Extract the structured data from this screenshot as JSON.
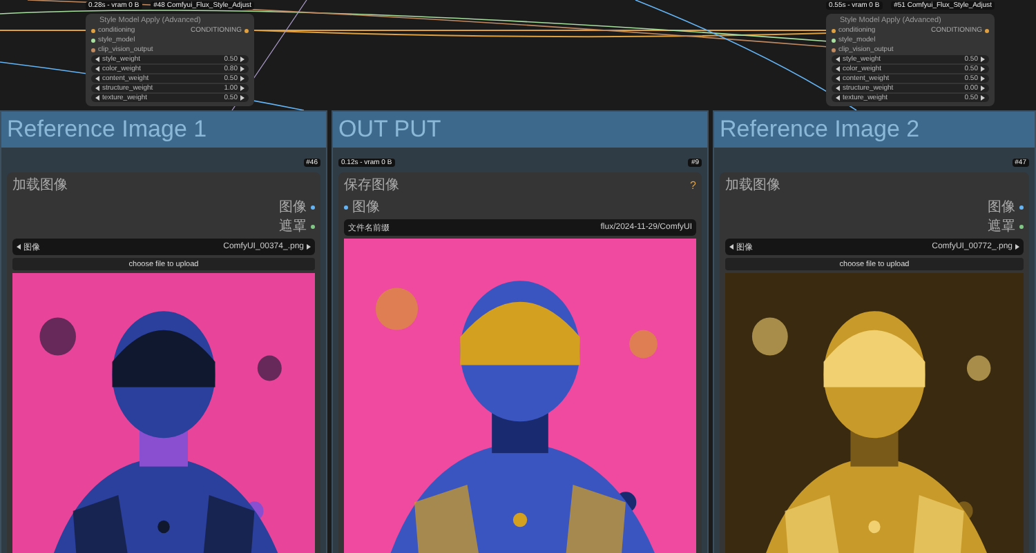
{
  "canvas_nodes": [
    {
      "timing": "0.28s - vram 0 B",
      "badge": "#48 Comfyui_Flux_Style_Adjust",
      "title": "Style Model Apply (Advanced)",
      "inputs": [
        {
          "name": "conditioning",
          "color": "#e0a040"
        },
        {
          "name": "style_model",
          "color": "#a8e0a0"
        },
        {
          "name": "clip_vision_output",
          "color": "#c08a60"
        }
      ],
      "output": {
        "name": "CONDITIONING",
        "color": "#e0a040"
      },
      "widgets": [
        {
          "label": "style_weight",
          "value": "0.50"
        },
        {
          "label": "color_weight",
          "value": "0.80"
        },
        {
          "label": "content_weight",
          "value": "0.50"
        },
        {
          "label": "structure_weight",
          "value": "1.00"
        },
        {
          "label": "texture_weight",
          "value": "0.50"
        }
      ]
    },
    {
      "timing": "0.55s - vram 0 B",
      "badge": "#51 Comfyui_Flux_Style_Adjust",
      "title": "Style Model Apply (Advanced)",
      "inputs": [
        {
          "name": "conditioning",
          "color": "#e0a040"
        },
        {
          "name": "style_model",
          "color": "#a8e0a0"
        },
        {
          "name": "clip_vision_output",
          "color": "#c08a60"
        }
      ],
      "output": {
        "name": "CONDITIONING",
        "color": "#e0a040"
      },
      "widgets": [
        {
          "label": "style_weight",
          "value": "0.50"
        },
        {
          "label": "color_weight",
          "value": "0.50"
        },
        {
          "label": "content_weight",
          "value": "0.50"
        },
        {
          "label": "structure_weight",
          "value": "0.00"
        },
        {
          "label": "texture_weight",
          "value": "0.50"
        }
      ]
    }
  ],
  "groups": [
    {
      "title": "Reference Image 1",
      "node": {
        "kind": "load_image",
        "badge": "#46",
        "title": "加载图像",
        "outputs": [
          {
            "name": "图像",
            "color": "#64b5f6"
          },
          {
            "name": "遮罩",
            "color": "#81c784"
          }
        ],
        "file": {
          "label": "图像",
          "value": "ComfyUI_00374_.png"
        },
        "upload": "choose file to upload"
      }
    },
    {
      "title": "OUT PUT",
      "node": {
        "kind": "save_image",
        "timing": "0.12s - vram 0 B",
        "badge": "#9",
        "title": "保存图像",
        "help": "?",
        "input": {
          "name": "图像",
          "color": "#64b5f6"
        },
        "field": {
          "label": "文件名前缀",
          "value": "flux/2024-11-29/ComfyUI"
        }
      }
    },
    {
      "title": "Reference Image 2",
      "node": {
        "kind": "load_image",
        "badge": "#47",
        "title": "加载图像",
        "outputs": [
          {
            "name": "图像",
            "color": "#64b5f6"
          },
          {
            "name": "遮罩",
            "color": "#81c784"
          }
        ],
        "file": {
          "label": "图像",
          "value": "ComfyUI_00772_.png"
        },
        "upload": "choose file to upload"
      }
    }
  ]
}
